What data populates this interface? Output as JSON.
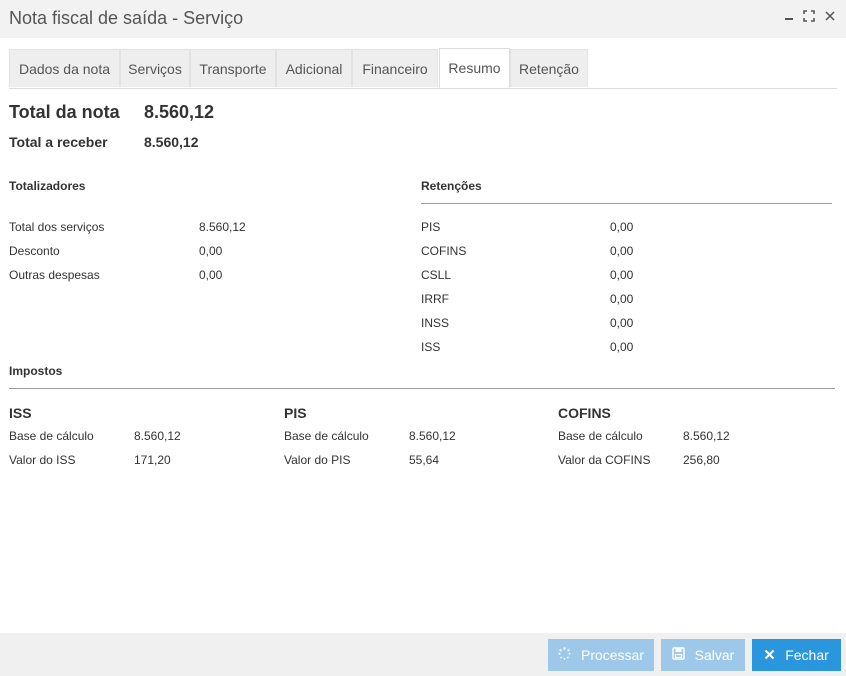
{
  "window": {
    "title": "Nota fiscal de saída - Serviço"
  },
  "tabs": [
    {
      "label": "Dados da nota"
    },
    {
      "label": "Serviços"
    },
    {
      "label": "Transporte"
    },
    {
      "label": "Adicional"
    },
    {
      "label": "Financeiro"
    },
    {
      "label": "Resumo",
      "active": true
    },
    {
      "label": "Retenção"
    }
  ],
  "summary": {
    "total_nota_label": "Total da nota",
    "total_nota_value": "8.560,12",
    "total_receber_label": "Total a receber",
    "total_receber_value": "8.560,12"
  },
  "totalizadores": {
    "title": "Totalizadores",
    "rows": [
      {
        "label": "Total dos serviços",
        "value": "8.560,12"
      },
      {
        "label": "Desconto",
        "value": "0,00"
      },
      {
        "label": "Outras despesas",
        "value": "0,00"
      }
    ]
  },
  "retencoes": {
    "title": "Retenções",
    "rows": [
      {
        "label": "PIS",
        "value": "0,00"
      },
      {
        "label": "COFINS",
        "value": "0,00"
      },
      {
        "label": "CSLL",
        "value": "0,00"
      },
      {
        "label": "IRRF",
        "value": "0,00"
      },
      {
        "label": "INSS",
        "value": "0,00"
      },
      {
        "label": "ISS",
        "value": "0,00"
      }
    ]
  },
  "impostos": {
    "title": "Impostos",
    "groups": [
      {
        "name": "ISS",
        "rows": [
          {
            "label": "Base de cálculo",
            "value": "8.560,12"
          },
          {
            "label": "Valor do ISS",
            "value": "171,20"
          }
        ]
      },
      {
        "name": "PIS",
        "rows": [
          {
            "label": "Base de cálculo",
            "value": "8.560,12"
          },
          {
            "label": "Valor do PIS",
            "value": "55,64"
          }
        ]
      },
      {
        "name": "COFINS",
        "rows": [
          {
            "label": "Base de cálculo",
            "value": "8.560,12"
          },
          {
            "label": "Valor da COFINS",
            "value": "256,80"
          }
        ]
      }
    ]
  },
  "footer": {
    "processar_label": "Processar",
    "salvar_label": "Salvar",
    "fechar_label": "Fechar"
  },
  "colors": {
    "primary": "#2a96dd",
    "disabled": "#9ec8ea"
  }
}
